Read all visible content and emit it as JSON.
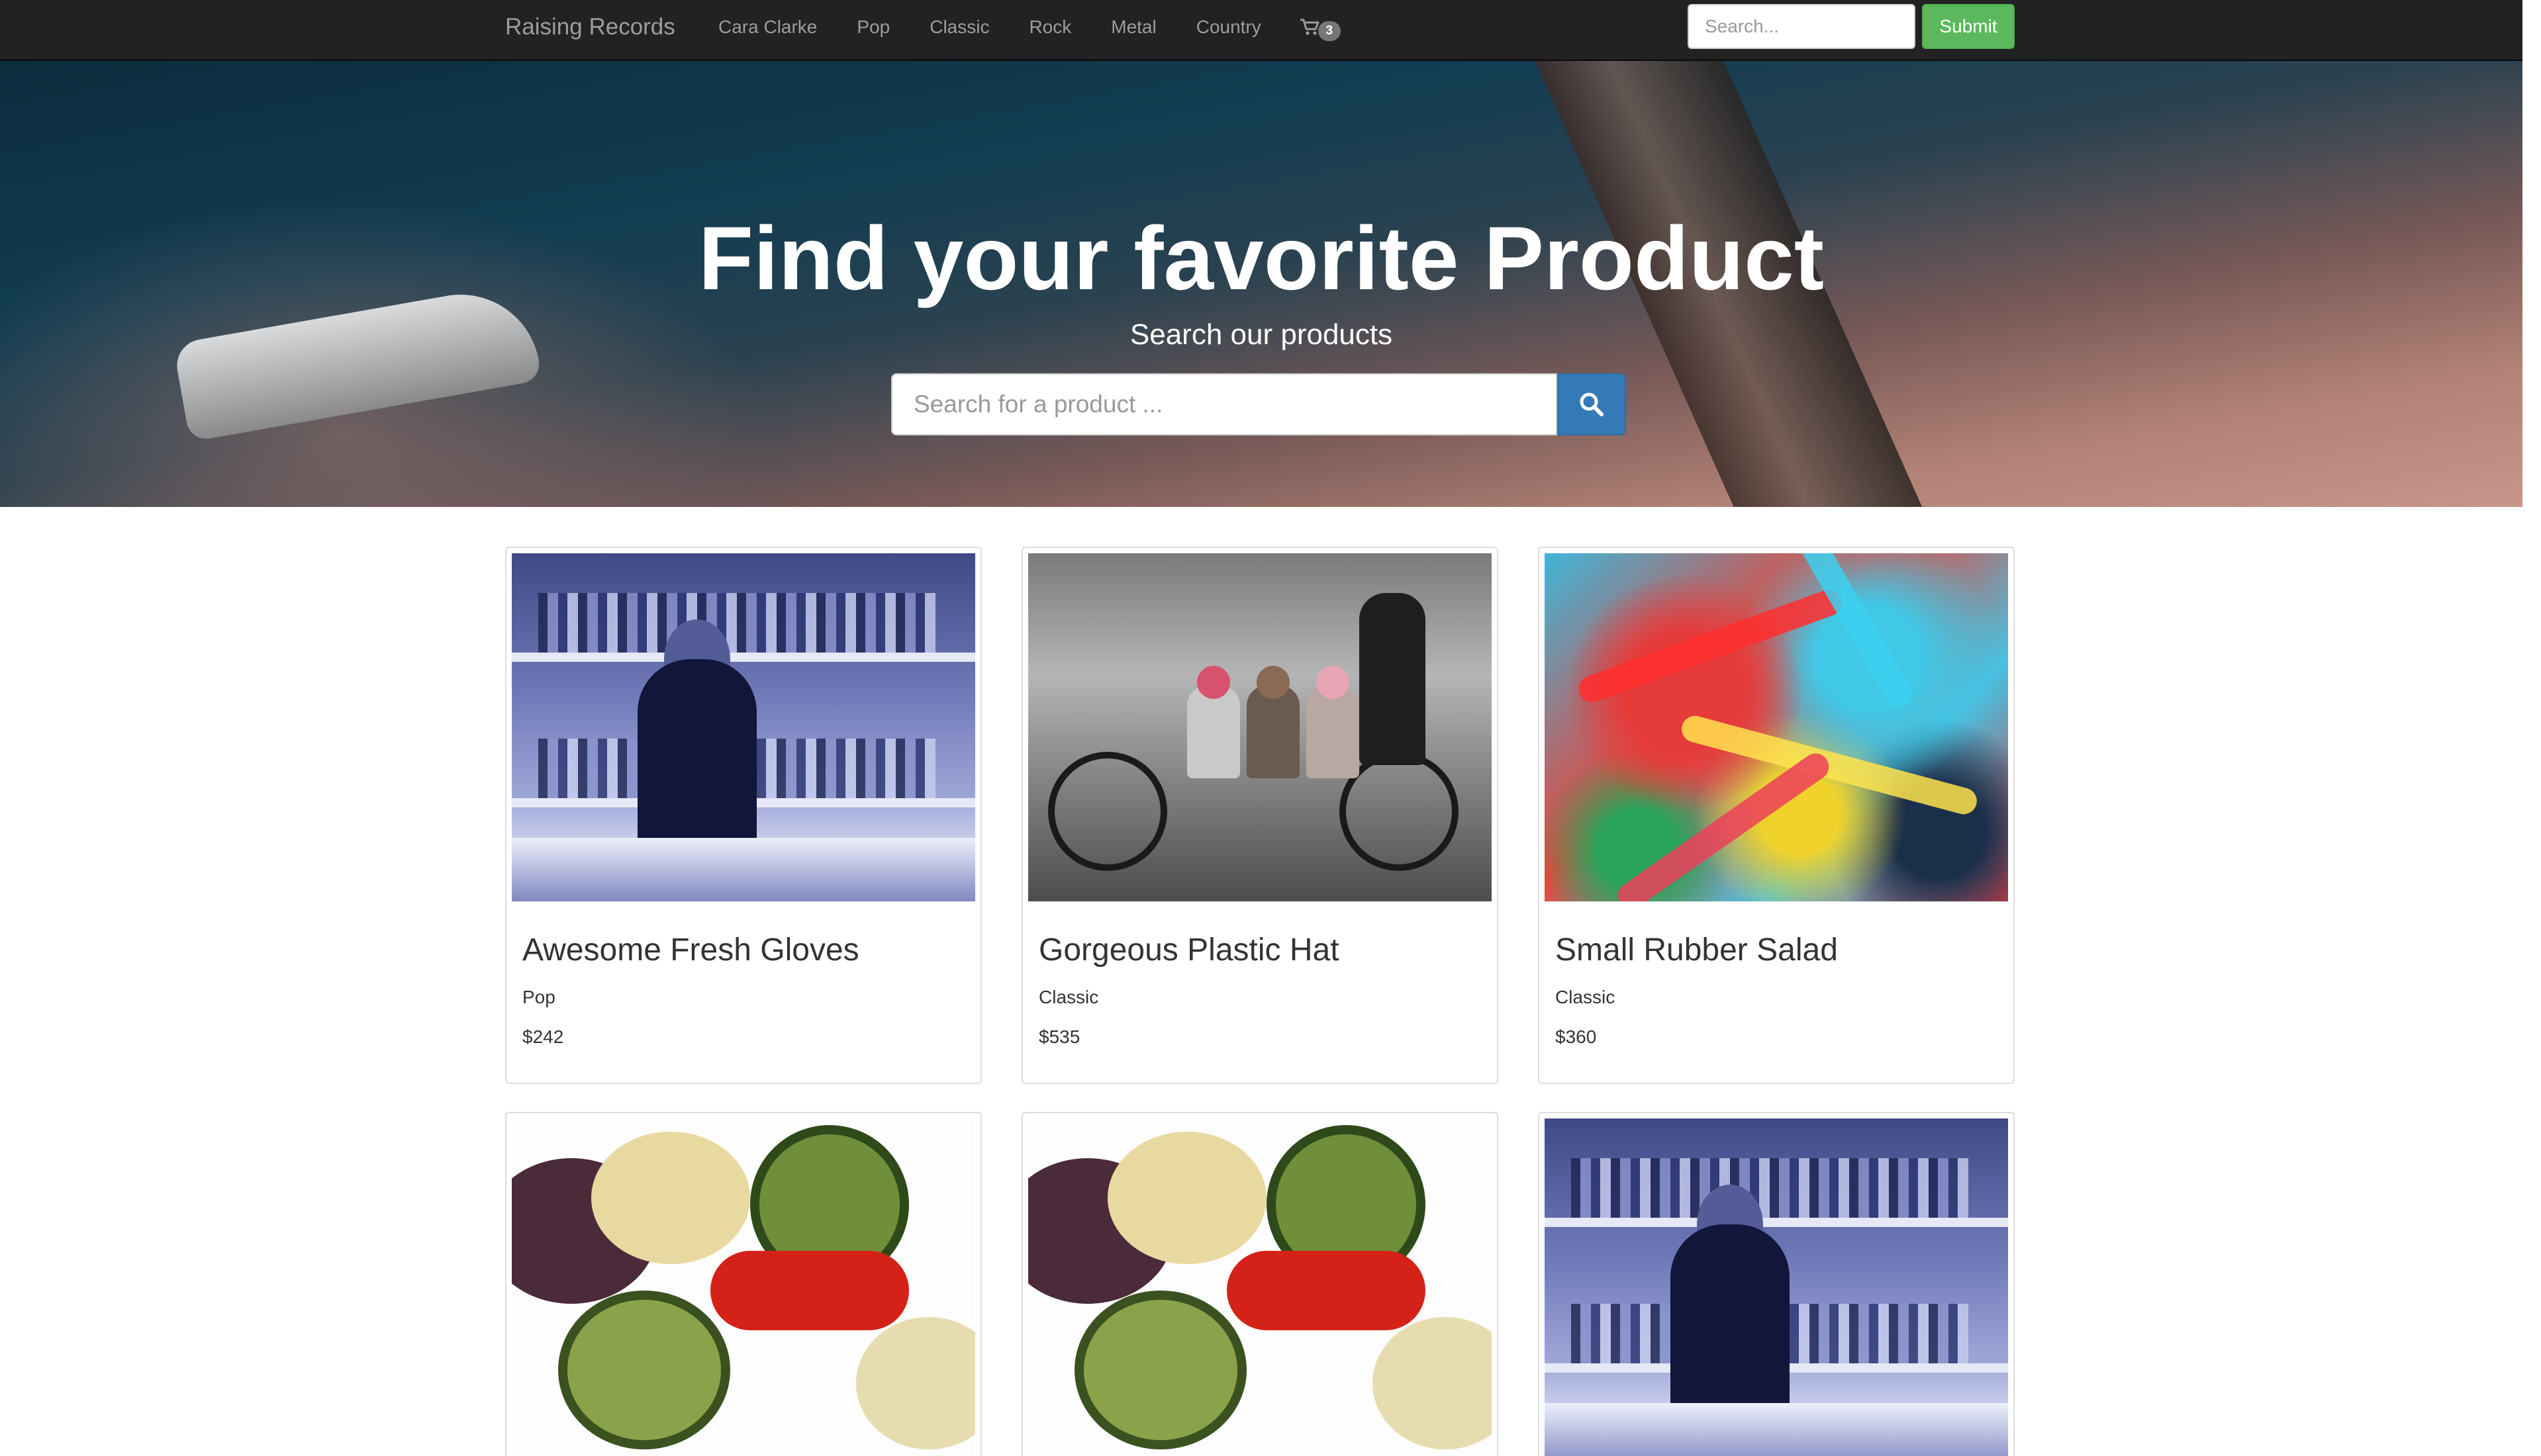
{
  "navbar": {
    "brand": "Raising Records",
    "links": [
      "Cara Clarke",
      "Pop",
      "Classic",
      "Rock",
      "Metal",
      "Country"
    ],
    "cart_icon": "shopping-cart-icon",
    "cart_count": "3",
    "search_placeholder": "Search...",
    "submit_label": "Submit"
  },
  "hero": {
    "title": "Find your favorite Product",
    "subtitle": "Search our products",
    "search_placeholder": "Search for a product ...",
    "search_icon": "search-icon"
  },
  "products": [
    {
      "title": "Awesome Fresh Gloves",
      "category": "Pop",
      "price": "$242",
      "image": "bartender"
    },
    {
      "title": "Gorgeous Plastic Hat",
      "category": "Classic",
      "price": "$535",
      "image": "tandem-bike"
    },
    {
      "title": "Small Rubber Salad",
      "category": "Classic",
      "price": "$360",
      "image": "abstract-paint"
    },
    {
      "title": "",
      "category": "",
      "price": "",
      "image": "grilled-vegetables"
    },
    {
      "title": "",
      "category": "",
      "price": "",
      "image": "grilled-vegetables"
    },
    {
      "title": "",
      "category": "",
      "price": "",
      "image": "bartender"
    }
  ],
  "colors": {
    "navbar_bg": "#222222",
    "submit_bg": "#5cb85c",
    "search_btn_bg": "#337ab7"
  }
}
